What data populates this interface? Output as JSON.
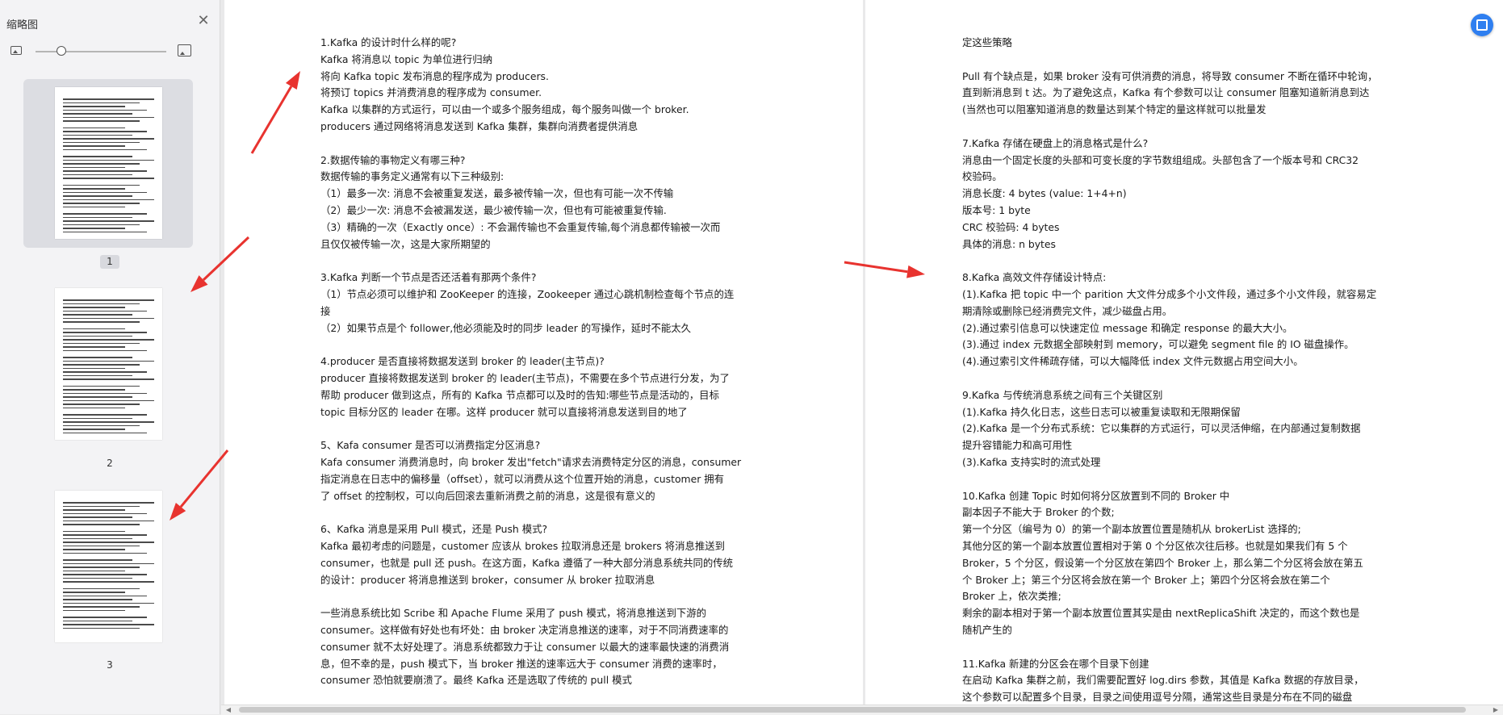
{
  "sidebar": {
    "title": "缩略图",
    "close_icon": "close-icon",
    "zoom": {
      "level": 0.2
    },
    "thumbnails": [
      {
        "label": "1",
        "active": true,
        "lines": 34
      },
      {
        "label": "2",
        "active": false,
        "lines": 34
      },
      {
        "label": "3",
        "active": false,
        "lines": 32
      }
    ]
  },
  "document": {
    "left_page": [
      {
        "lines": [
          "1.Kafka 的设计时什么样的呢?",
          "Kafka 将消息以 topic 为单位进行归纳",
          "将向 Kafka topic 发布消息的程序成为 producers.",
          "将预订 topics 并消费消息的程序成为 consumer.",
          "Kafka 以集群的方式运行，可以由一个或多个服务组成，每个服务叫做一个 broker.",
          "producers 通过网络将消息发送到 Kafka 集群，集群向消费者提供消息"
        ]
      },
      {
        "lines": [
          "2.数据传输的事物定义有哪三种?",
          "数据传输的事务定义通常有以下三种级别:",
          "（1）最多一次: 消息不会被重复发送，最多被传输一次，但也有可能一次不传输",
          "（2）最少一次: 消息不会被漏发送，最少被传输一次，但也有可能被重复传输.",
          "（3）精确的一次（Exactly   once）:   不会漏传输也不会重复传输,每个消息都传输被一次而",
          "且仅仅被传输一次，这是大家所期望的"
        ]
      },
      {
        "lines": [
          "3.Kafka 判断一个节点是否还活着有那两个条件?",
          "（1）节点必须可以维护和 ZooKeeper 的连接，Zookeeper 通过心跳机制检查每个节点的连",
          "接",
          "（2）如果节点是个 follower,他必须能及时的同步 leader 的写操作，延时不能太久"
        ]
      },
      {
        "lines": [
          "4.producer 是否直接将数据发送到 broker 的 leader(主节点)?",
          "producer 直接将数据发送到 broker 的 leader(主节点)，不需要在多个节点进行分发，为了",
          "帮助 producer 做到这点，所有的 Kafka 节点都可以及时的告知:哪些节点是活动的，目标",
          "topic 目标分区的 leader 在哪。这样 producer 就可以直接将消息发送到目的地了"
        ]
      },
      {
        "lines": [
          "5、Kafa consumer 是否可以消费指定分区消息?",
          "Kafa    consumer 消费消息时，向 broker 发出\"fetch\"请求去消费特定分区的消息，consumer",
          "指定消息在日志中的偏移量（offset），就可以消费从这个位置开始的消息，customer 拥有",
          "了 offset 的控制权，可以向后回滚去重新消费之前的消息，这是很有意义的"
        ]
      },
      {
        "lines": [
          "6、Kafka 消息是采用 Pull 模式，还是 Push 模式?",
          "Kafka 最初考虑的问题是，customer 应该从 brokes 拉取消息还是 brokers 将消息推送到",
          "consumer，也就是 pull 还 push。在这方面，Kafka 遵循了一种大部分消息系统共同的传统",
          "的设计：producer 将消息推送到 broker，consumer 从 broker 拉取消息"
        ]
      },
      {
        "lines": [
          "一些消息系统比如 Scribe 和 Apache              Flume 采用了 push 模式，将消息推送到下游的",
          "consumer。这样做有好处也有坏处：由 broker 决定消息推送的速率，对于不同消费速率的",
          "consumer 就不太好处理了。消息系统都致力于让 consumer 以最大的速率最快速的消费消",
          "息，但不幸的是，push 模式下，当 broker 推送的速率远大于 consumer 消费的速率时，",
          "consumer 恐怕就要崩溃了。最终 Kafka 还是选取了传统的 pull 模式"
        ]
      }
    ],
    "right_page": [
      {
        "lines": [
          "定这些策略"
        ]
      },
      {
        "lines": [
          "Pull 有个缺点是，如果 broker 没有可供消费的消息，将导致 consumer 不断在循环中轮询，",
          "直到新消息到 t 达。为了避免这点，Kafka 有个参数可以让 consumer 阻塞知道新消息到达",
          "(当然也可以阻塞知道消息的数量达到某个特定的量这样就可以批量发"
        ]
      },
      {
        "lines": [
          "7.Kafka 存储在硬盘上的消息格式是什么?",
          "消息由一个固定长度的头部和可变长度的字节数组组成。头部包含了一个版本号和 CRC32",
          "校验码。",
          "消息长度: 4 bytes (value: 1+4+n)",
          "版本号: 1 byte",
          "CRC 校验码: 4 bytes",
          "具体的消息: n bytes"
        ]
      },
      {
        "lines": [
          "8.Kafka 高效文件存储设计特点:",
          "(1).Kafka 把 topic 中一个 parition 大文件分成多个小文件段，通过多个小文件段，就容易定",
          "期清除或删除已经消费完文件，减少磁盘占用。",
          "(2).通过索引信息可以快速定位 message 和确定 response 的最大大小。",
          "(3).通过 index 元数据全部映射到 memory，可以避免 segment file 的 IO 磁盘操作。",
          "(4).通过索引文件稀疏存储，可以大幅降低 index 文件元数据占用空间大小。"
        ]
      },
      {
        "lines": [
          "9.Kafka  与传统消息系统之间有三个关键区别",
          "(1).Kafka  持久化日志，这些日志可以被重复读取和无限期保留",
          "(2).Kafka    是一个分布式系统：它以集群的方式运行，可以灵活伸缩，在内部通过复制数据",
          "提升容错能力和高可用性",
          "(3).Kafka  支持实时的流式处理"
        ]
      },
      {
        "lines": [
          "10.Kafka 创建 Topic 时如何将分区放置到不同的 Broker 中",
          "副本因子不能大于  Broker  的个数;",
          "第一个分区（编号为 0）的第一个副本放置位置是随机从  brokerList  选择的;",
          "其他分区的第一个副本放置位置相对于第 0 个分区依次往后移。也就是如果我们有 5 个",
          "Broker，5 个分区，假设第一个分区放在第四个    Broker    上，那么第二个分区将会放在第五",
          "个      Broker      上；第三个分区将会放在第一个      Broker      上；第四个分区将会放在第二个",
          "Broker 上，依次类推;",
          "剩余的副本相对于第一个副本放置位置其实是由    nextReplicaShift    决定的，而这个数也是",
          "随机产生的"
        ]
      },
      {
        "lines": [
          "11.Kafka 新建的分区会在哪个目录下创建",
          "在启动   Kafka   集群之前，我们需要配置好   log.dirs   参数，其值是   Kafka   数据的存放目录，",
          "这个参数可以配置多个目录，目录之间使用逗号分隔，通常这些目录是分布在不同的磁盘"
        ]
      }
    ]
  },
  "colors": {
    "accent": "#2f7ff0",
    "annotation_arrow": "#e8332f"
  },
  "floating_button": {
    "icon": "translate-icon"
  }
}
